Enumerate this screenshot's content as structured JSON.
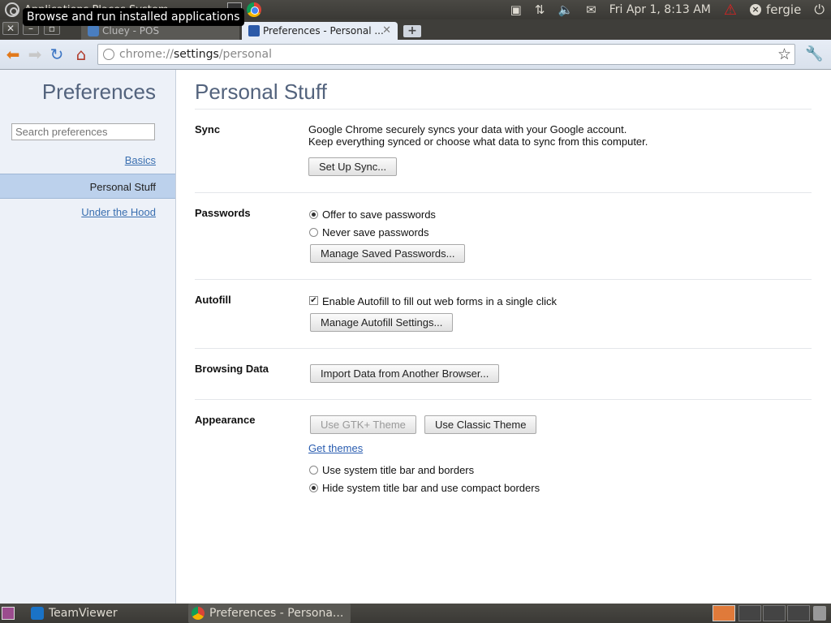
{
  "top_panel": {
    "menus": "Applications  Places  System",
    "tooltip": "Browse and run installed applications",
    "datetime": "Fri Apr  1,  8:13 AM",
    "user": "fergie"
  },
  "tabs": [
    {
      "title": "Cluey - POS",
      "active": false
    },
    {
      "title": "Preferences - Personal ...",
      "active": true
    }
  ],
  "toolbar": {
    "url_scheme": "chrome://",
    "url_host": "settings",
    "url_path": "/personal"
  },
  "sidebar": {
    "title": "Preferences",
    "search_placeholder": "Search preferences",
    "items": [
      {
        "label": "Basics",
        "selected": false
      },
      {
        "label": "Personal Stuff",
        "selected": true
      },
      {
        "label": "Under the Hood",
        "selected": false
      }
    ]
  },
  "main": {
    "title": "Personal Stuff",
    "sync": {
      "label": "Sync",
      "line1": "Google Chrome securely syncs your data with your Google account.",
      "line2": "Keep everything synced or choose what data to sync from this computer.",
      "button": "Set Up Sync..."
    },
    "passwords": {
      "label": "Passwords",
      "offer": "Offer to save passwords",
      "never": "Never save passwords",
      "button": "Manage Saved Passwords...",
      "selected": "offer"
    },
    "autofill": {
      "label": "Autofill",
      "checkbox": "Enable Autofill to fill out web forms in a single click",
      "checked": true,
      "button": "Manage Autofill Settings..."
    },
    "browsing": {
      "label": "Browsing Data",
      "button": "Import Data from Another Browser..."
    },
    "appearance": {
      "label": "Appearance",
      "gtk_button": "Use GTK+ Theme",
      "classic_button": "Use Classic Theme",
      "get_themes": "Get themes",
      "system_title": "Use system title bar and borders",
      "hide_title": "Hide system title bar and use compact borders",
      "selected": "hide_title"
    }
  },
  "bottom_panel": {
    "tasks": [
      {
        "label": "TeamViewer"
      },
      {
        "label": "Preferences - Persona..."
      }
    ]
  }
}
